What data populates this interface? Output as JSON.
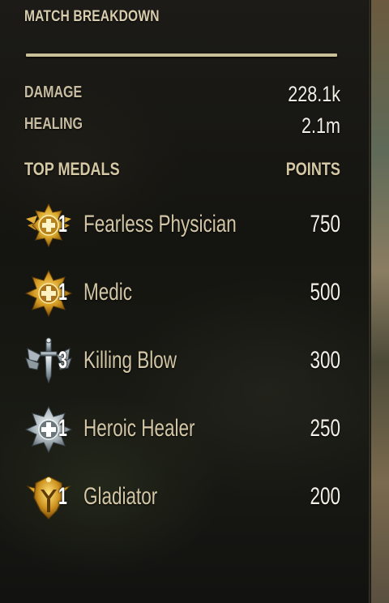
{
  "panel": {
    "title": "MATCH BREAKDOWN"
  },
  "stats": [
    {
      "label": "DAMAGE",
      "value": "228.1k"
    },
    {
      "label": "HEALING",
      "value": "2.1m"
    }
  ],
  "medals_header": {
    "left": "TOP MEDALS",
    "right": "POINTS"
  },
  "medals": [
    {
      "icon": "fearless-physician-medal-icon",
      "count": "1",
      "name": "Fearless Physician",
      "points": "750"
    },
    {
      "icon": "medic-medal-icon",
      "count": "1",
      "name": "Medic",
      "points": "500"
    },
    {
      "icon": "killing-blow-medal-icon",
      "count": "3",
      "name": "Killing Blow",
      "points": "300"
    },
    {
      "icon": "heroic-healer-medal-icon",
      "count": "1",
      "name": "Heroic Healer",
      "points": "250"
    },
    {
      "icon": "gladiator-medal-icon",
      "count": "1",
      "name": "Gladiator",
      "points": "200"
    }
  ],
  "colors": {
    "gold_medal": "#d9a62a",
    "silver_medal": "#b9c3c8",
    "label_text": "#c8bda2",
    "value_text": "#f2efe6"
  }
}
